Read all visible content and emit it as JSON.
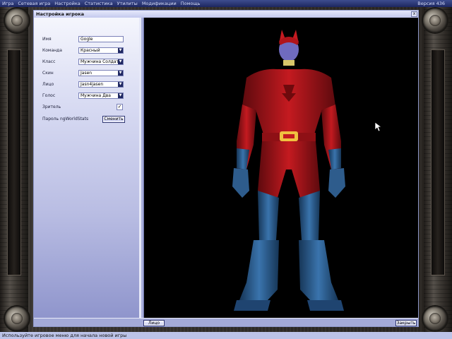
{
  "menubar": {
    "items": [
      "Игра",
      "Сетевая игра",
      "Настройка",
      "Статистика",
      "Утилиты",
      "Модификации",
      "Помощь"
    ],
    "version": "Версия 436"
  },
  "dialog": {
    "title": "Настройка игрока",
    "close_label": "x",
    "fields": {
      "name_label": "Имя",
      "name_value": "Gogle",
      "team_label": "Команда",
      "team_value": "Красный",
      "class_label": "Класс",
      "class_value": "Мужчина Солдат",
      "skin_label": "Скин",
      "skin_value": "Jasen",
      "face_label": "Лицо",
      "face_value": "Jasn4jasen",
      "voice_label": "Голос",
      "voice_value": "Мужчина Два",
      "spectator_label": "Зритель",
      "spectator_checked": true,
      "spectator_mark": "✓",
      "password_label": "Пароль ngWorldStats",
      "change_button": "Сменить"
    },
    "face_tab": "Лицо",
    "close_button": "Закрыть"
  },
  "statusbar": {
    "text": "Используйте игровое меню для начала новой игры"
  },
  "colors": {
    "menubar": "#2a3675",
    "panel_accent": "#1f2761",
    "costume_red": "#b0141a",
    "costume_blue": "#2e5c8c"
  }
}
